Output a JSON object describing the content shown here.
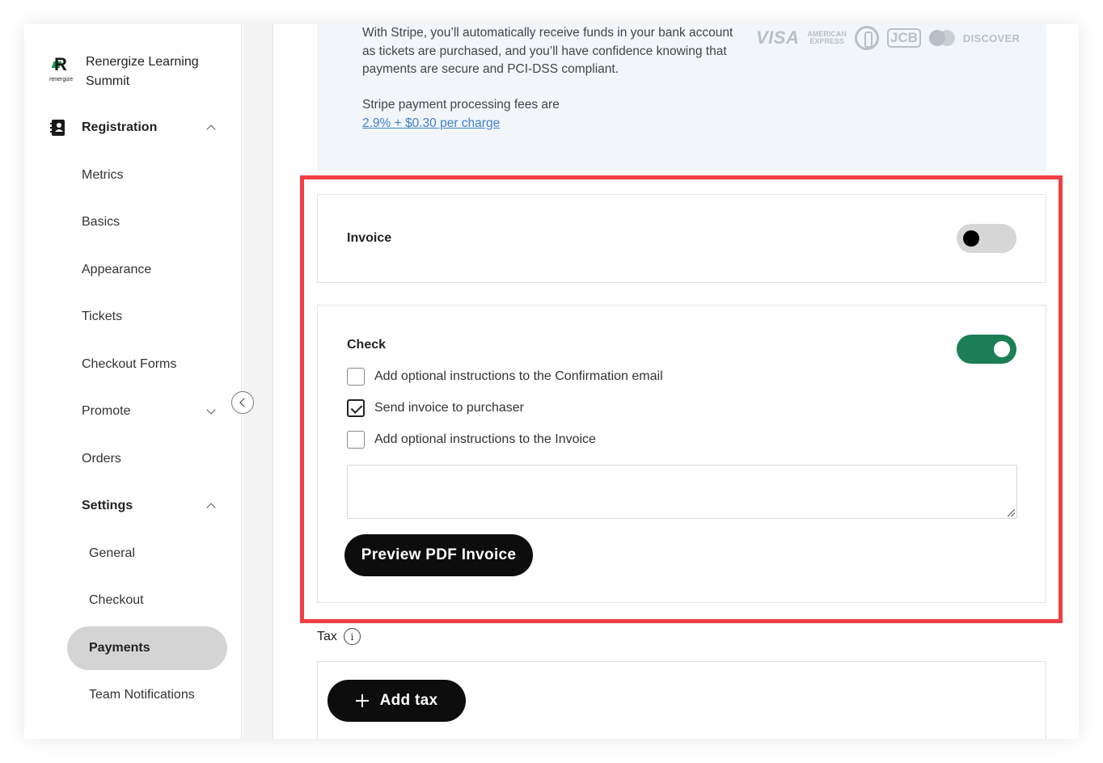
{
  "org": {
    "name": "Renergize Learning Summit",
    "logo_letter": "R",
    "logo_word": "renergize"
  },
  "sidebar": {
    "section_label": "Registration",
    "items": [
      {
        "label": "Metrics"
      },
      {
        "label": "Basics"
      },
      {
        "label": "Appearance"
      },
      {
        "label": "Tickets"
      },
      {
        "label": "Checkout Forms"
      },
      {
        "label": "Promote"
      },
      {
        "label": "Orders"
      },
      {
        "label": "Settings"
      }
    ],
    "settings_items": [
      {
        "label": "General"
      },
      {
        "label": "Checkout"
      },
      {
        "label": "Payments"
      },
      {
        "label": "Team Notifications"
      }
    ],
    "active_item": "Payments"
  },
  "stripe": {
    "description": "With Stripe, you’ll automatically receive funds in your bank account as tickets are purchased, and you’ll have confidence knowing that payments are secure and PCI-DSS compliant.",
    "fee_text": "Stripe payment processing fees are",
    "fee_link": "2.9% + $0.30 per charge",
    "cards": {
      "visa": "VISA",
      "amex_line1": "AMERICAN",
      "amex_line2": "EXPRESS",
      "jcb": "JCB",
      "discover": "DISCOVER"
    }
  },
  "invoice": {
    "title": "Invoice",
    "enabled": false
  },
  "check": {
    "title": "Check",
    "enabled": true,
    "options": [
      {
        "label": "Add optional instructions to the Confirmation email",
        "checked": false
      },
      {
        "label": "Send invoice to purchaser",
        "checked": true
      },
      {
        "label": "Add optional instructions to the Invoice",
        "checked": false
      }
    ],
    "instructions_value": "",
    "preview_button": "Preview PDF Invoice"
  },
  "tax": {
    "label": "Tax",
    "info_glyph": "i",
    "add_button": "Add tax"
  },
  "colors": {
    "toggle_on": "#1b7e55",
    "highlight": "#ef3f45",
    "link": "#3f7fc8",
    "active_nav": "#d4d4d4"
  }
}
